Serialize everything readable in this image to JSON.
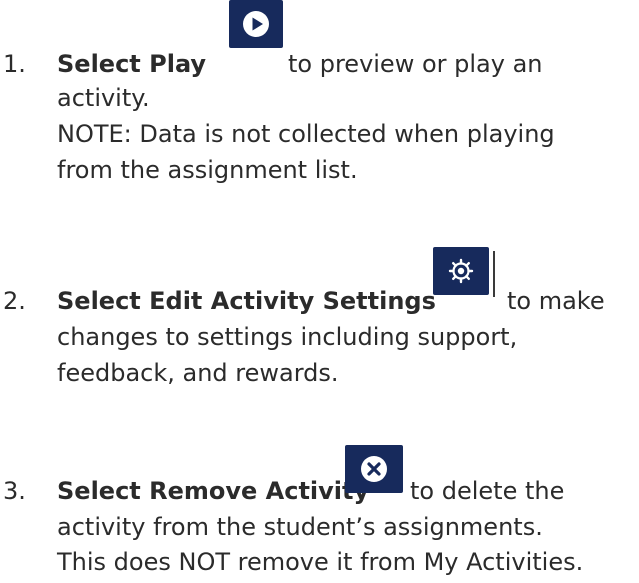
{
  "steps": [
    {
      "number": "1.",
      "title": "Select Play",
      "icon": "play-icon",
      "lines": [
        "to preview or play an",
        "activity.",
        "NOTE: Data is not collected when playing",
        "from the assignment list."
      ]
    },
    {
      "number": "2.",
      "title": "Select Edit Activity Settings",
      "icon": "gear-icon",
      "lines": [
        "to make",
        "changes to settings including support,",
        "feedback, and rewards."
      ]
    },
    {
      "number": "3.",
      "title": "Select Remove Activity",
      "icon": "close-icon",
      "lines": [
        "to delete the",
        "activity from the student’s assignments.",
        "This does NOT remove it from My Activities."
      ]
    }
  ],
  "colors": {
    "icon_background": "#172a5c",
    "text": "#2b2b2b"
  }
}
